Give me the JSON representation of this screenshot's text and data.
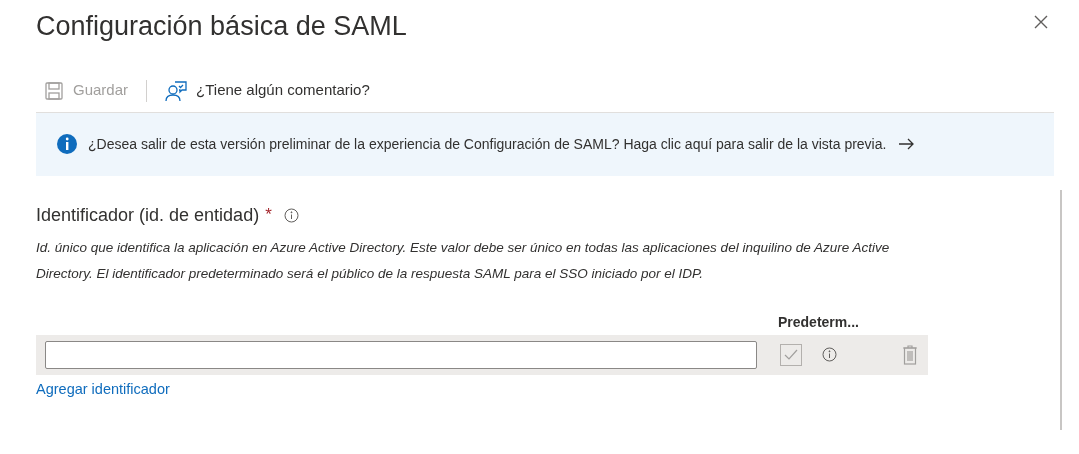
{
  "panel": {
    "title": "Configuración básica de SAML"
  },
  "toolbar": [
    {
      "kind": "save",
      "label": "Guardar",
      "disabled": true
    },
    {
      "kind": "feedback",
      "label": "¿Tiene algún comentario?",
      "disabled": false
    }
  ],
  "banner": {
    "text": "¿Desea salir de esta versión preliminar de la experiencia de Configuración de SAML? Haga clic aquí para salir de la vista previa."
  },
  "identifier": {
    "label": "Identificador (id. de entidad)",
    "required": true,
    "required_mark": "*",
    "description": "Id. único que identifica la aplicación en Azure Active Directory. Este valor debe ser único en todas las aplicaciones del inquilino de Azure Active Directory. El identificador predeterminado será el público de la respuesta SAML para el SSO iniciado por el IDP.",
    "column_header": "Predeterm...",
    "rows": [
      {
        "default_checked": true,
        "disabled": true
      }
    ],
    "add_link": "Agregar identificador"
  }
}
